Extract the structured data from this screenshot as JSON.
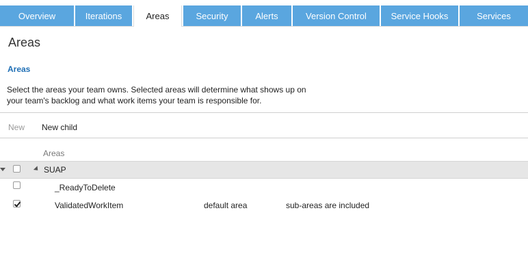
{
  "tabs": [
    {
      "label": "Overview",
      "active": false
    },
    {
      "label": "Iterations",
      "active": false
    },
    {
      "label": "Areas",
      "active": true
    },
    {
      "label": "Security",
      "active": false
    },
    {
      "label": "Alerts",
      "active": false
    },
    {
      "label": "Version Control",
      "active": false
    },
    {
      "label": "Service Hooks",
      "active": false
    },
    {
      "label": "Services",
      "active": false
    }
  ],
  "page": {
    "title": "Areas",
    "section_title": "Areas",
    "description": "Select the areas your team owns. Selected areas will determine what shows up on your team's backlog and what work items your team is responsible for."
  },
  "toolbar": {
    "new_label": "New",
    "new_child_label": "New child"
  },
  "grid": {
    "column_header": "Areas",
    "rows": [
      {
        "name": "SUAP",
        "checked": false,
        "default": "",
        "subareas": ""
      },
      {
        "name": "_ReadyToDelete",
        "checked": false,
        "default": "",
        "subareas": ""
      },
      {
        "name": "ValidatedWorkItem",
        "checked": true,
        "default": "default area",
        "subareas": "sub-areas are included"
      }
    ]
  },
  "colors": {
    "tab_bg": "#5aa6df",
    "accent_link": "#1f6fb5",
    "selected_row_bg": "#e6e6e6"
  }
}
